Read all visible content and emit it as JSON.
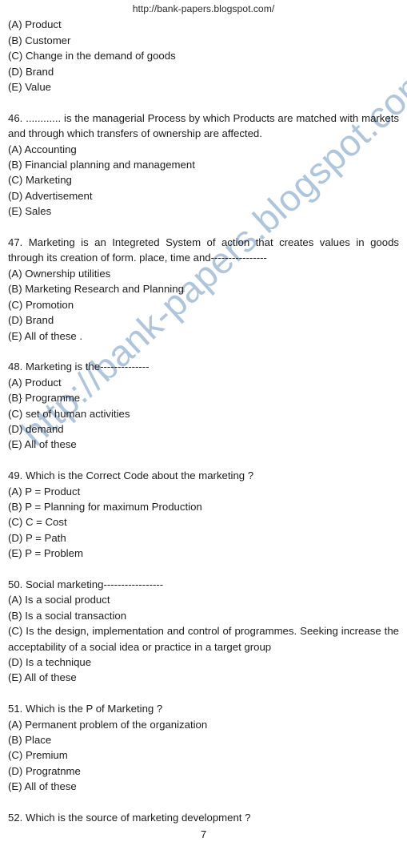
{
  "header": {
    "url": "http://bank-papers.blogspot.com/"
  },
  "watermark": {
    "text": "http://bank-papers.blogspot.com/",
    "color": "#aec5de"
  },
  "page_number": "7",
  "blocks": [
    {
      "id": "q45-options-continued",
      "stem": null,
      "options": [
        "(A) Product",
        "(B) Customer",
        "(C) Change in the demand of goods",
        "(D) Brand",
        "(E) Value"
      ]
    },
    {
      "id": "q46",
      "stem": "46. ............ is the managerial Process by which Products are matched with markets and through which transfers of ownership are affected.",
      "options": [
        "(A) Accounting",
        "(B) Financial planning and management",
        "(C) Marketing",
        "(D) Advertisement",
        "(E) Sales"
      ]
    },
    {
      "id": "q47",
      "stem": "47. Marketing is an Integreted System of action that creates values in goods through its creation of form. place, time and----------------",
      "options": [
        "(A) Ownership utilities",
        "(B) Marketing Research and Planning",
        "(C) Promotion",
        "(D) Brand",
        "(E) All of these ."
      ]
    },
    {
      "id": "q48",
      "stem": "48. Marketing is the--------------",
      "options": [
        "(A) Product",
        "(B} Programme",
        "(C) set of human activities",
        "(D) demand",
        "(E) All of these"
      ]
    },
    {
      "id": "q49",
      "stem": "49. Which is the Correct Code about the marketing ?",
      "options": [
        "(A) P = Product",
        "(B) P = Planning for maximum Production",
        "(C) C = Cost",
        "(D) P = Path",
        "(E) P = Problem"
      ]
    },
    {
      "id": "q50",
      "stem": "50. Social marketing-----------------",
      "options": [
        "(A) Is a social product",
        "(B) Is a social transaction",
        "(C) Is the design, implementation and control of programmes. Seeking increase the acceptability of a social idea or practice in a target group",
        "(D) Is a technique",
        "(E) All of these"
      ]
    },
    {
      "id": "q51",
      "stem": "51. Which is the P of Marketing ?",
      "options": [
        "(A) Permanent problem of the organization",
        "(B) Place",
        "(C) Premium",
        "(D) Progratnme",
        "(E) All of these"
      ]
    },
    {
      "id": "q52",
      "stem": "52. Which is the source of marketing development ?",
      "options": []
    }
  ]
}
